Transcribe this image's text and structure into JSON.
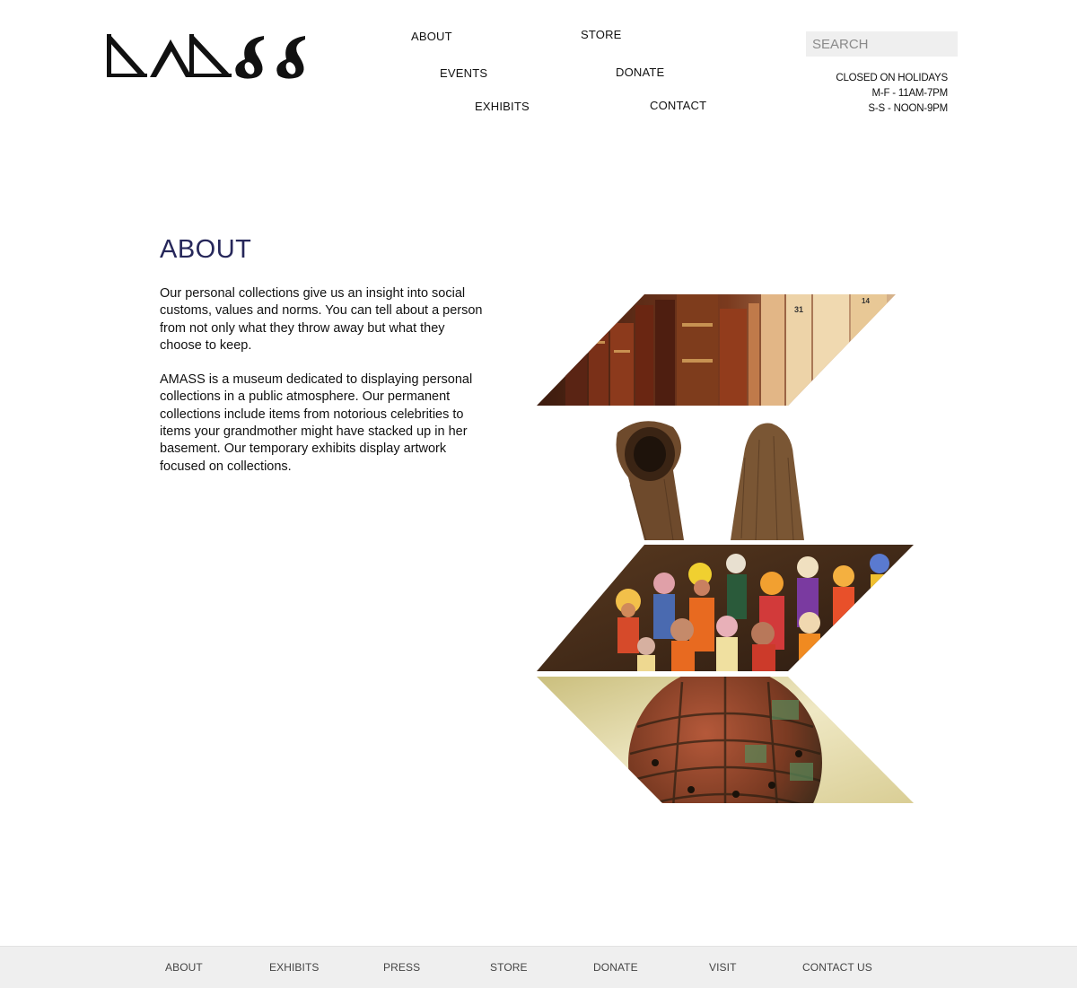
{
  "brand": {
    "name": "AMASS",
    "logo_icon": "amass-wordmark"
  },
  "header": {
    "nav": {
      "about": "ABOUT",
      "store": "STORE",
      "events": "EVENTS",
      "donate": "DONATE",
      "exhibits": "EXHIBITS",
      "contact": "CONTACT"
    },
    "search": {
      "placeholder": "SEARCH",
      "value": ""
    },
    "hours": {
      "line1": "CLOSED ON HOLIDAYS",
      "line2": "M-F - 11AM-7PM",
      "line3": "S-S - NOON-9PM"
    }
  },
  "main": {
    "title": "ABOUT",
    "paragraph1": "Our personal collections give us an insight into social customs, values and norms. You can tell about a person from not only what they throw away but what they choose to keep.",
    "paragraph2": "AMASS is a museum dedicated to displaying personal collections in a public atmosphere. Our permanent collections include items from notorious celebrities to items your grandmother might have stacked up in her basement. Our temporary exhibits display artwork focused on collections."
  },
  "collage": {
    "panels": [
      "books-photo",
      "woven-sculpture-photo",
      "figurines-photo",
      "sphere-sculpture-photo"
    ]
  },
  "footer": {
    "links": [
      "ABOUT",
      "EXHIBITS",
      "PRESS",
      "STORE",
      "DONATE",
      "VISIT",
      "CONTACT US"
    ]
  },
  "colors": {
    "title": "#26275a",
    "footer_bg": "#efefef",
    "search_bg": "#efefef"
  }
}
